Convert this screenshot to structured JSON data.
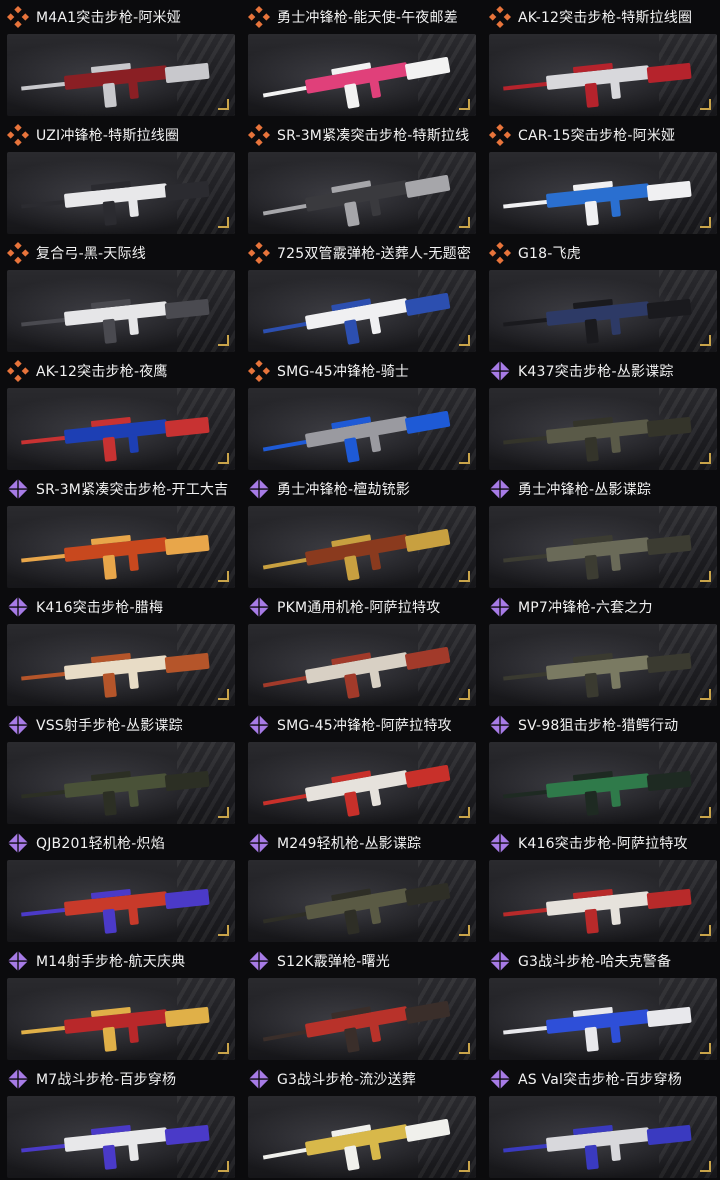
{
  "colors": {
    "legendary_icon": "#e8743b",
    "epic_icon": "#a77be6",
    "background": "#0b0b0d"
  },
  "items": [
    {
      "label": "M4A1突击步枪-阿米娅",
      "rarity": "legendary",
      "skin": [
        "#8a1f24",
        "#c8c8cc"
      ]
    },
    {
      "label": "勇士冲锋枪-能天使-午夜邮差",
      "rarity": "legendary",
      "skin": [
        "#e0407a",
        "#f2f2f2"
      ]
    },
    {
      "label": "AK-12突击步枪-特斯拉线圈",
      "rarity": "legendary",
      "skin": [
        "#d8d8dc",
        "#b5232c"
      ]
    },
    {
      "label": "UZI冲锋枪-特斯拉线圈",
      "rarity": "legendary",
      "skin": [
        "#e8e8ea",
        "#2b2b30"
      ]
    },
    {
      "label": "SR-3M紧凑突击步枪-特斯拉线",
      "rarity": "legendary",
      "skin": [
        "#3a3a3e",
        "#a6a6aa"
      ]
    },
    {
      "label": "CAR-15突击步枪-阿米娅",
      "rarity": "legendary",
      "skin": [
        "#2a6fd0",
        "#f0f0f2"
      ]
    },
    {
      "label": "复合弓-黑-天际线",
      "rarity": "legendary",
      "skin": [
        "#e6e6e8",
        "#4a4a50"
      ]
    },
    {
      "label": "725双管霰弹枪-送葬人-无题密",
      "rarity": "legendary",
      "skin": [
        "#f0f0f2",
        "#2c4fb0"
      ]
    },
    {
      "label": "G18-飞虎",
      "rarity": "legendary",
      "skin": [
        "#2d3a66",
        "#1a1a1e"
      ]
    },
    {
      "label": "AK-12突击步枪-夜鹰",
      "rarity": "legendary",
      "skin": [
        "#1d3fb4",
        "#c83232"
      ]
    },
    {
      "label": "SMG-45冲锋枪-骑士",
      "rarity": "legendary",
      "skin": [
        "#9a9aa0",
        "#1e5ad6"
      ]
    },
    {
      "label": "K437突击步枪-丛影谍踪",
      "rarity": "epic",
      "skin": [
        "#5a5a48",
        "#34342a"
      ]
    },
    {
      "label": "SR-3M紧凑突击步枪-开工大吉",
      "rarity": "epic",
      "skin": [
        "#c8481e",
        "#e8a64a"
      ]
    },
    {
      "label": "勇士冲锋枪-檀劫铳影",
      "rarity": "epic",
      "skin": [
        "#8a3a1e",
        "#c8a040"
      ]
    },
    {
      "label": "勇士冲锋枪-丛影谍踪",
      "rarity": "epic",
      "skin": [
        "#6a6a58",
        "#3c3c32"
      ]
    },
    {
      "label": "K416突击步枪-腊梅",
      "rarity": "epic",
      "skin": [
        "#e8dcc6",
        "#b5552a"
      ]
    },
    {
      "label": "PKM通用机枪-阿萨拉特攻",
      "rarity": "epic",
      "skin": [
        "#d8d0c4",
        "#a23a2a"
      ]
    },
    {
      "label": "MP7冲锋枪-六套之力",
      "rarity": "epic",
      "skin": [
        "#7a7a62",
        "#3a3a30"
      ]
    },
    {
      "label": "VSS射手步枪-丛影谍踪",
      "rarity": "epic",
      "skin": [
        "#4a5238",
        "#2c2f24"
      ]
    },
    {
      "label": "SMG-45冲锋枪-阿萨拉特攻",
      "rarity": "epic",
      "skin": [
        "#e6e2dc",
        "#c8302a"
      ]
    },
    {
      "label": "SV-98狙击步枪-猎鳄行动",
      "rarity": "epic",
      "skin": [
        "#2f7a4a",
        "#1e2a22"
      ]
    },
    {
      "label": "QJB201轻机枪-炽焰",
      "rarity": "epic",
      "skin": [
        "#c83a2a",
        "#4b3ac8"
      ]
    },
    {
      "label": "M249轻机枪-丛影谍踪",
      "rarity": "epic",
      "skin": [
        "#5a5a44",
        "#2e2e26"
      ]
    },
    {
      "label": "K416突击步枪-阿萨拉特攻",
      "rarity": "epic",
      "skin": [
        "#e6e2dc",
        "#b82a2a"
      ]
    },
    {
      "label": "M14射手步枪-航天庆典",
      "rarity": "epic",
      "skin": [
        "#b8282a",
        "#e0b048"
      ]
    },
    {
      "label": "S12K霰弹枪-曙光",
      "rarity": "epic",
      "skin": [
        "#b8322a",
        "#3a2e2a"
      ]
    },
    {
      "label": "G3战斗步枪-哈夫克警备",
      "rarity": "epic",
      "skin": [
        "#2e4fd8",
        "#e8e8ec"
      ]
    },
    {
      "label": "M7战斗步枪-百步穿杨",
      "rarity": "epic",
      "skin": [
        "#e8e8ea",
        "#4a3ac8"
      ]
    },
    {
      "label": "G3战斗步枪-流沙送葬",
      "rarity": "epic",
      "skin": [
        "#d8b84a",
        "#f0f0ec"
      ]
    },
    {
      "label": "AS Val突击步枪-百步穿杨",
      "rarity": "epic",
      "skin": [
        "#d8d8dc",
        "#3a3ac0"
      ]
    }
  ]
}
